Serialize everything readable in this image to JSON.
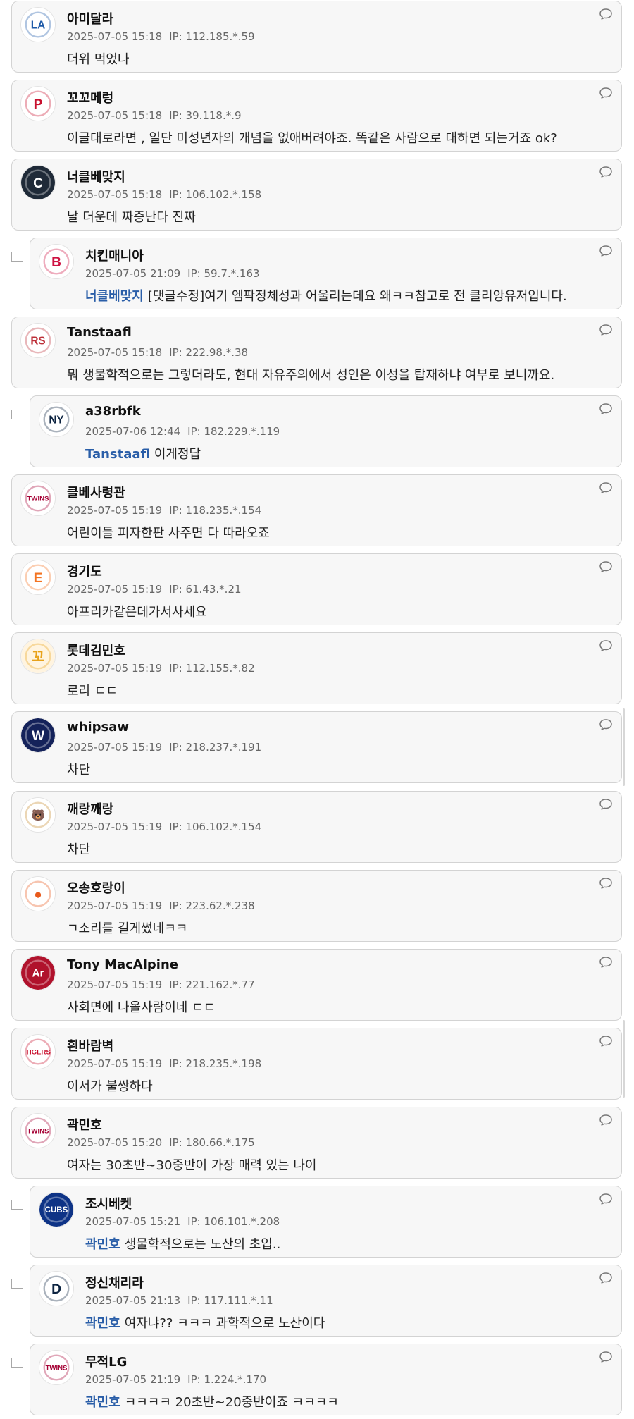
{
  "comments": [
    {
      "nickname": "아미달라",
      "date": "2025-07-05 15:18",
      "ip": "IP: 112.185.*.59",
      "text": "더위 먹었나",
      "reply": false,
      "mention": "",
      "avatar": {
        "icon": "dodgers-logo-icon",
        "bg": "#ffffff",
        "fg": "#1e5aa8",
        "glyph": "LA"
      }
    },
    {
      "nickname": "꼬꼬메렁",
      "date": "2025-07-05 15:18",
      "ip": "IP: 39.118.*.9",
      "text": "이글대로라면 , 일단 미성년자의 개념을 없애버려야죠. 똑같은 사람으로 대하면 되는거죠 ok?",
      "reply": false,
      "mention": "",
      "avatar": {
        "icon": "phillies-logo-icon",
        "bg": "#ffffff",
        "fg": "#c8102e",
        "glyph": "P"
      }
    },
    {
      "nickname": "너클베맞지",
      "date": "2025-07-05 15:18",
      "ip": "IP: 106.102.*.158",
      "text": "날 더운데 짜증난다 진짜",
      "reply": false,
      "mention": "",
      "avatar": {
        "icon": "c-logo-icon",
        "bg": "#1f2a38",
        "fg": "#ffffff",
        "glyph": "C"
      }
    },
    {
      "nickname": "치킨매니아",
      "date": "2025-07-05 21:09",
      "ip": "IP: 59.7.*.163",
      "text": "[댓글수정]여기 엠팍정체성과 어울리는데요 왜ㅋㅋ참고로 전 클리앙유저입니다.",
      "reply": true,
      "mention": "너클베맞지",
      "avatar": {
        "icon": "braves-logo-icon",
        "bg": "#ffffff",
        "fg": "#ce1141",
        "glyph": "B"
      }
    },
    {
      "nickname": "Tanstaafl",
      "date": "2025-07-05 15:18",
      "ip": "IP: 222.98.*.38",
      "text": "뭐 생물학적으로는 그렇더라도, 현대 자유주의에서 성인은 이성을 탑재하냐 여부로 보니까요.",
      "reply": false,
      "mention": "",
      "avatar": {
        "icon": "red-sox-logo-icon",
        "bg": "#ffffff",
        "fg": "#bd3039",
        "glyph": "RS"
      }
    },
    {
      "nickname": "a38rbfk",
      "date": "2025-07-06 12:44",
      "ip": "IP: 182.229.*.119",
      "text": "이게정답",
      "reply": true,
      "mention": "Tanstaafl",
      "avatar": {
        "icon": "yankees-logo-icon",
        "bg": "#ffffff",
        "fg": "#0c2340",
        "glyph": "NY"
      }
    },
    {
      "nickname": "클베사령관",
      "date": "2025-07-05 15:19",
      "ip": "IP: 118.235.*.154",
      "text": "어린이들 피자한판 사주면 다 따라오죠",
      "reply": false,
      "mention": "",
      "avatar": {
        "icon": "lg-twins-logo-icon",
        "bg": "#ffffff",
        "fg": "#a50034",
        "glyph": "TWINS"
      }
    },
    {
      "nickname": "경기도",
      "date": "2025-07-05 15:19",
      "ip": "IP: 61.43.*.21",
      "text": "아프리카같은데가서사세요",
      "reply": false,
      "mention": "",
      "avatar": {
        "icon": "eagles-logo-icon",
        "bg": "#ffffff",
        "fg": "#f37321",
        "glyph": "E"
      }
    },
    {
      "nickname": "롯데김민호",
      "date": "2025-07-05 15:19",
      "ip": "IP: 112.155.*.82",
      "text": "로리 ㄷㄷ",
      "reply": false,
      "mention": "",
      "avatar": {
        "icon": "snack-logo-icon",
        "bg": "#fff4e0",
        "fg": "#e8a21a",
        "glyph": "꼬"
      }
    },
    {
      "nickname": "whipsaw",
      "date": "2025-07-05 15:19",
      "ip": "IP: 218.237.*.191",
      "text": "차단",
      "reply": false,
      "mention": "",
      "avatar": {
        "icon": "nationals-logo-icon",
        "bg": "#14225a",
        "fg": "#ffffff",
        "glyph": "W"
      }
    },
    {
      "nickname": "깨랑깨랑",
      "date": "2025-07-05 15:19",
      "ip": "IP: 106.102.*.154",
      "text": "차단",
      "reply": false,
      "mention": "",
      "avatar": {
        "icon": "bear-character-icon",
        "bg": "#ffffff",
        "fg": "#c58a2b",
        "glyph": "🐻"
      }
    },
    {
      "nickname": "오송호랑이",
      "date": "2025-07-05 15:19",
      "ip": "IP: 223.62.*.238",
      "text": "ㄱ소리를 길게썼네ㅋㅋ",
      "reply": false,
      "mention": "",
      "avatar": {
        "icon": "orange-ball-logo-icon",
        "bg": "#ffffff",
        "fg": "#e85a1c",
        "glyph": "●"
      }
    },
    {
      "nickname": "Tony MacAlpine",
      "date": "2025-07-05 15:19",
      "ip": "IP: 221.162.*.77",
      "text": "사회면에 나올사람이네 ㄷㄷ",
      "reply": false,
      "mention": "",
      "avatar": {
        "icon": "arsenal-logo-icon",
        "bg": "#b0122c",
        "fg": "#ffffff",
        "glyph": "Ar"
      }
    },
    {
      "nickname": "흰바람벽",
      "date": "2025-07-05 15:19",
      "ip": "IP: 218.235.*.198",
      "text": "이서가 불쌍하다",
      "reply": false,
      "mention": "",
      "avatar": {
        "icon": "kia-tigers-logo-icon",
        "bg": "#ffffff",
        "fg": "#c8102e",
        "glyph": "TIGERS"
      }
    },
    {
      "nickname": "곽민호",
      "date": "2025-07-05 15:20",
      "ip": "IP: 180.66.*.175",
      "text": "여자는 30초반~30중반이 가장 매력 있는 나이",
      "reply": false,
      "mention": "",
      "avatar": {
        "icon": "lg-twins-logo-icon",
        "bg": "#ffffff",
        "fg": "#a50034",
        "glyph": "TWINS"
      }
    },
    {
      "nickname": "조시베켓",
      "date": "2025-07-05 15:21",
      "ip": "IP: 106.101.*.208",
      "text": "생물학적으로는 노산의 초입..",
      "reply": true,
      "mention": "곽민호",
      "avatar": {
        "icon": "cubs-logo-icon",
        "bg": "#0e3386",
        "fg": "#ffffff",
        "glyph": "CUBS"
      }
    },
    {
      "nickname": "정신채리라",
      "date": "2025-07-05 21:13",
      "ip": "IP: 117.111.*.11",
      "text": "여자냐?? ㅋㅋㅋ 과학적으로 노산이다",
      "reply": true,
      "mention": "곽민호",
      "avatar": {
        "icon": "tigers-d-logo-icon",
        "bg": "#ffffff",
        "fg": "#0c2340",
        "glyph": "D"
      }
    },
    {
      "nickname": "무적LG",
      "date": "2025-07-05 21:19",
      "ip": "IP: 1.224.*.170",
      "text": "ㅋㅋㅋㅋ 20초반~20중반이죠 ㅋㅋㅋㅋ",
      "reply": true,
      "mention": "곽민호",
      "avatar": {
        "icon": "lg-twins-logo-icon",
        "bg": "#ffffff",
        "fg": "#a50034",
        "glyph": "TWINS"
      }
    }
  ]
}
